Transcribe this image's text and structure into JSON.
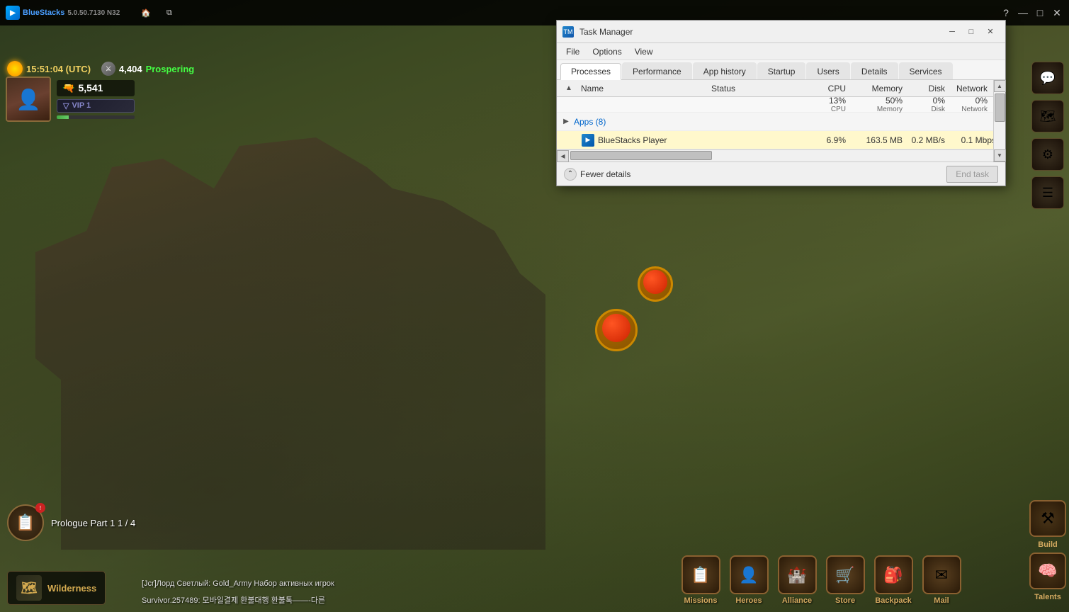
{
  "app": {
    "name": "BlueStacks",
    "version": "5.0.50.7130 N32"
  },
  "titlebar": {
    "title": "BlueStacks 5.0.50.7130 N32",
    "tabs": [
      "Home",
      "Multi-Instance"
    ],
    "controls": {
      "help": "?",
      "minimize": "—",
      "restore": "□",
      "close": "✕"
    }
  },
  "game": {
    "time": "15:51:04 (UTC)",
    "resource_count": "4,404",
    "status": "Prospering",
    "player": {
      "soldier_count": "5,541",
      "vip_level": "VIP 1"
    }
  },
  "quest": {
    "text": "Prologue Part 1 1 / 4"
  },
  "chat": {
    "line1": "[Jcr]Лорд Светлый: Gold_Army Набор активных игрок",
    "line2": "Survivor.257489: 모바일결제 환불대행 환불톡——-다른"
  },
  "nav_buttons": [
    {
      "label": "Missions",
      "icon": "📋"
    },
    {
      "label": "Heroes",
      "icon": "👤"
    },
    {
      "label": "Alliance",
      "icon": "🏰"
    },
    {
      "label": "Store",
      "icon": "🛒"
    },
    {
      "label": "Backpack",
      "icon": "🎒"
    },
    {
      "label": "Mail",
      "icon": "✉"
    }
  ],
  "sidebar_right": [
    {
      "label": "Build",
      "icon": "⚒"
    },
    {
      "label": "Talents",
      "icon": "🧠"
    }
  ],
  "wilderness": {
    "label": "Wilderness"
  },
  "task_manager": {
    "title": "Task Manager",
    "menu_items": [
      "File",
      "Options",
      "View"
    ],
    "tabs": [
      {
        "label": "Processes",
        "active": true
      },
      {
        "label": "Performance",
        "active": false
      },
      {
        "label": "App history",
        "active": false
      },
      {
        "label": "Startup",
        "active": false
      },
      {
        "label": "Users",
        "active": false
      },
      {
        "label": "Details",
        "active": false
      },
      {
        "label": "Services",
        "active": false
      }
    ],
    "columns": {
      "name": "Name",
      "status": "Status",
      "cpu": "CPU",
      "memory": "Memory",
      "disk": "Disk",
      "network": "Network"
    },
    "stats": {
      "cpu_pct": "13%",
      "cpu_label": "CPU",
      "mem_pct": "50%",
      "mem_label": "Memory",
      "disk_pct": "0%",
      "disk_label": "Disk",
      "net_pct": "0%",
      "net_label": "Network"
    },
    "groups": [
      {
        "label": "Apps (8)",
        "expanded": true,
        "processes": [
          {
            "name": "BlueStacks Player",
            "status": "",
            "cpu": "6.9%",
            "memory": "163.5 MB",
            "disk": "0.2 MB/s",
            "network": "0.1 Mbps",
            "highlighted": true
          }
        ]
      }
    ],
    "footer": {
      "fewer_details": "Fewer details",
      "end_task": "End task"
    },
    "controls": {
      "minimize": "─",
      "restore": "□",
      "close": "✕"
    }
  }
}
